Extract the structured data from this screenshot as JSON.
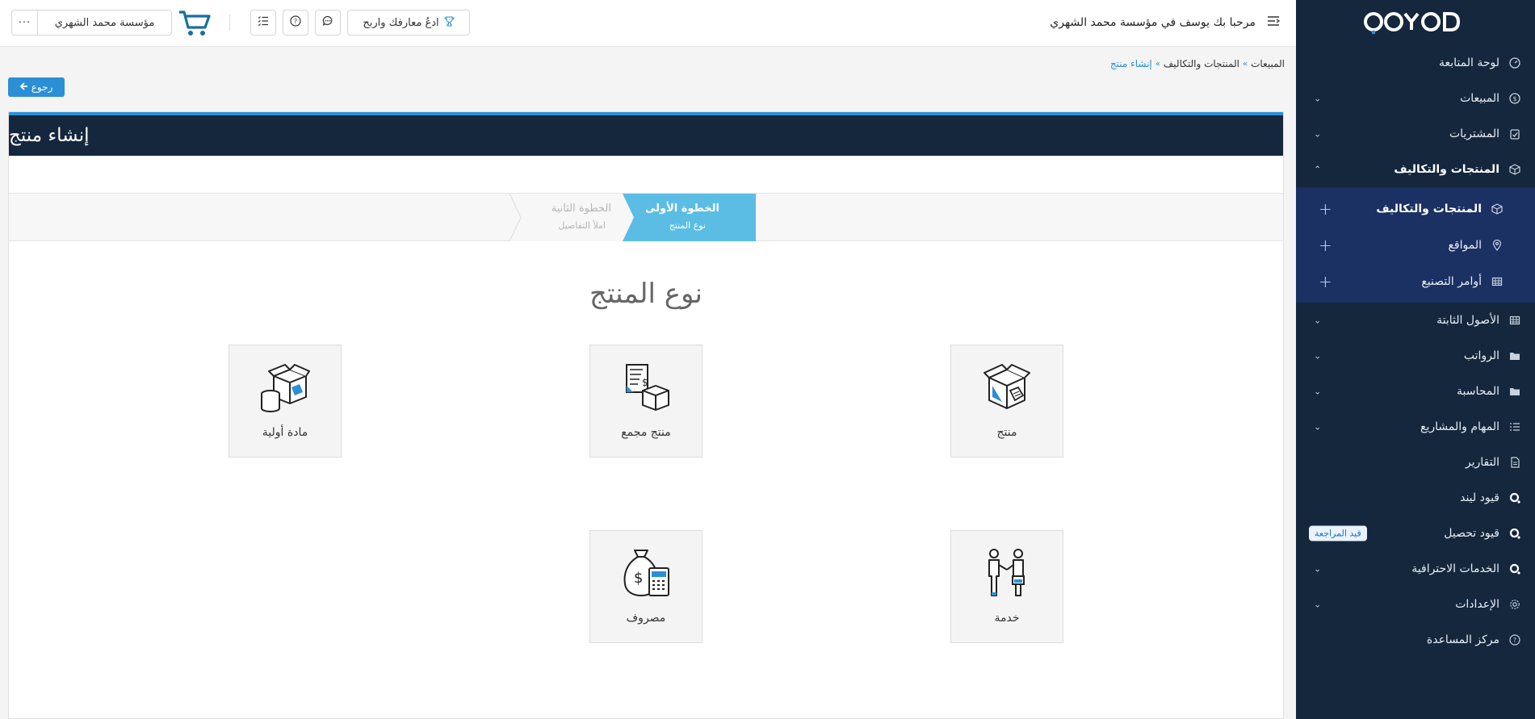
{
  "colors": {
    "sidebar_bg": "#14273d",
    "submenu_bg": "#1b3164",
    "accent": "#2b8fd6",
    "wizard_active": "#5bbde4"
  },
  "sidebar": {
    "logo": "QOYOD",
    "items": [
      {
        "label": "لوحة المتابعة",
        "icon": "speedometer-icon"
      },
      {
        "label": "المبيعات",
        "icon": "dollar-circle-icon"
      },
      {
        "label": "المشتريات",
        "icon": "checklist-icon"
      },
      {
        "label": "المنتجات والتكاليف",
        "icon": "box-icon"
      },
      {
        "label": "الأصول الثابتة",
        "icon": "grid-icon"
      },
      {
        "label": "الرواتب",
        "icon": "folder-icon"
      },
      {
        "label": "المحاسبة",
        "icon": "folder-icon"
      },
      {
        "label": "المهام والمشاريع",
        "icon": "list-icon"
      },
      {
        "label": "التقارير",
        "icon": "document-icon"
      },
      {
        "label": "قيود ليند",
        "icon": "q-icon"
      },
      {
        "label": "قيود تحصيل",
        "icon": "q-icon",
        "badge": "قيد المراجعة"
      },
      {
        "label": "الخدمات الاحترافية",
        "icon": "q-icon"
      },
      {
        "label": "الإعدادات",
        "icon": "gear-icon"
      },
      {
        "label": "مركز المساعدة",
        "icon": "help-circle-icon"
      }
    ],
    "subitems": [
      {
        "label": "المنتجات والتكاليف",
        "icon": "box-icon"
      },
      {
        "label": "المواقع",
        "icon": "location-icon"
      },
      {
        "label": "أوامر التصنيع",
        "icon": "table-icon"
      }
    ]
  },
  "topbar": {
    "welcome": "مرحبا بك يوسف في مؤسسة محمد الشهري",
    "invite_label": "ادعُ معارفك واربح",
    "company_name": "مؤسسة محمد الشهري",
    "more_label": "···"
  },
  "breadcrumb": [
    "المبيعات",
    "المنتجات والتكاليف",
    "إنشاء منتج"
  ],
  "back_label": "رجوع",
  "page_title": "إنشاء منتج",
  "wizard": {
    "step1_title": "الخطوة الأولى",
    "step1_sub": "نوع المنتج",
    "step2_title": "الخطوة الثانية",
    "step2_sub": "املأ التفاصيل"
  },
  "section_title": "نوع المنتج",
  "types": {
    "product": "منتج",
    "bundle": "منتج مجمع",
    "raw": "مادة أولية",
    "service": "خدمة",
    "expense": "مصروف"
  }
}
